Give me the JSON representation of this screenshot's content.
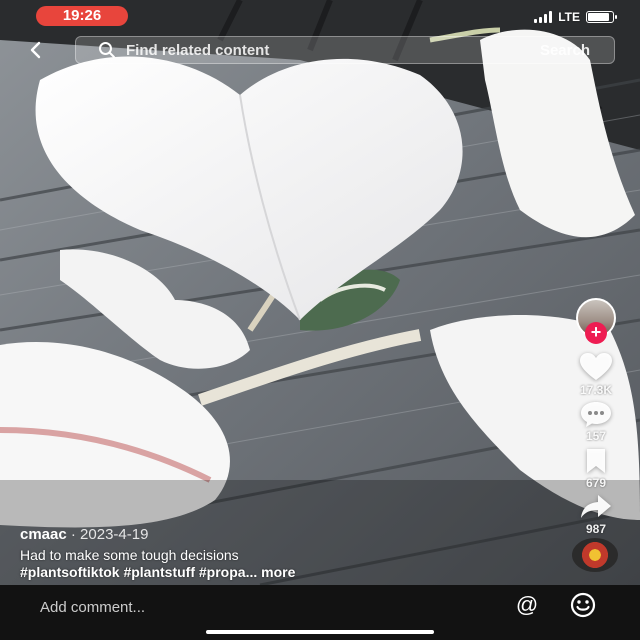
{
  "status": {
    "time": "19:26",
    "network": "LTE",
    "battery_level": 0.9
  },
  "search": {
    "placeholder": "Find related content",
    "button_label": "Search"
  },
  "rail": {
    "likes": "17.3K",
    "comments": "157",
    "saves": "679",
    "shares": "987"
  },
  "post": {
    "username": "cmaac",
    "date": "· 2023-4-19",
    "description": "Had to make some tough decisions",
    "tags": "#plantsoftiktok #plantstuff #propa...",
    "more_label": " more"
  },
  "comment": {
    "placeholder": "Add comment..."
  },
  "icons": {
    "back": "chevron-left-icon",
    "search": "search-icon",
    "like": "heart-icon",
    "comment": "comment-bubble-icon",
    "save": "bookmark-icon",
    "share": "share-arrow-icon",
    "mention": "at-sign-icon",
    "emoji": "smiley-icon"
  },
  "colors": {
    "status_pill": "#e8453c",
    "follow_badge": "#ee1d52",
    "comment_bar": "#121212"
  }
}
